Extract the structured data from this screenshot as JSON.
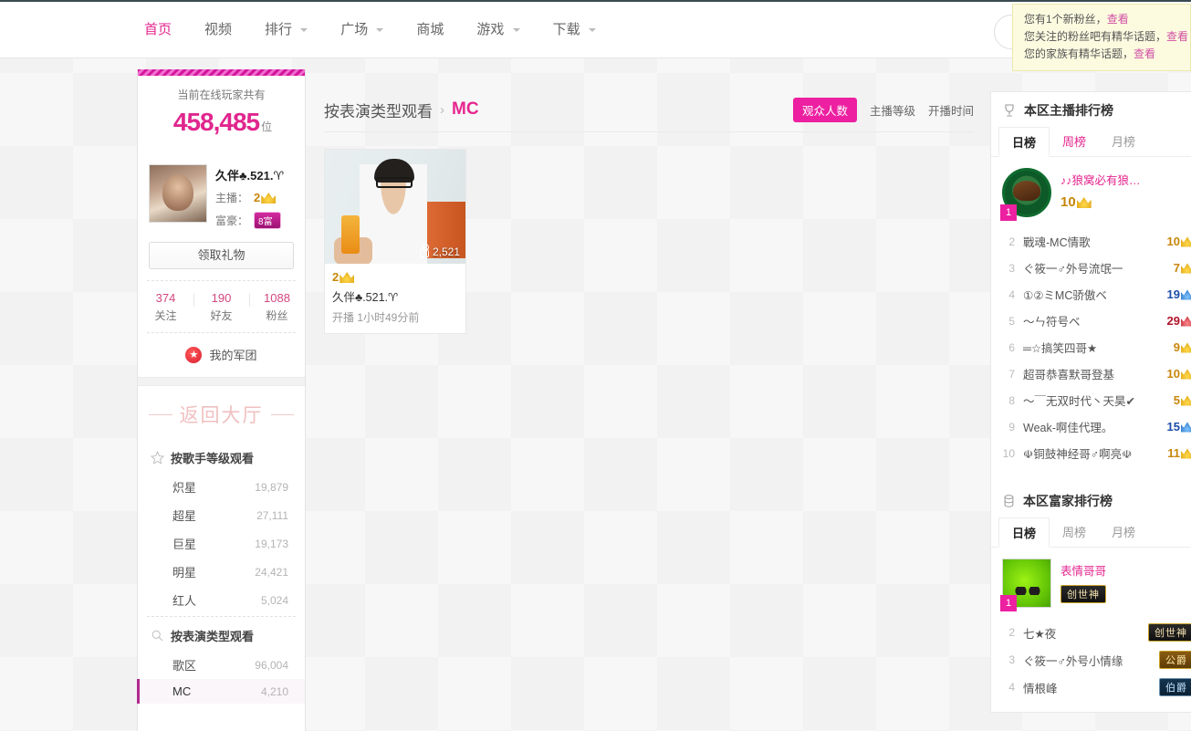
{
  "nav": {
    "items": [
      {
        "label": "首页",
        "caret": false,
        "active": true
      },
      {
        "label": "视频",
        "caret": false,
        "active": false
      },
      {
        "label": "排行",
        "caret": true,
        "active": false
      },
      {
        "label": "广场",
        "caret": true,
        "active": false
      },
      {
        "label": "商城",
        "caret": false,
        "active": false
      },
      {
        "label": "游戏",
        "caret": true,
        "active": false
      },
      {
        "label": "下载",
        "caret": true,
        "active": false
      }
    ]
  },
  "notify": {
    "rows": [
      {
        "text": "您有1个新粉丝，",
        "link": "查看"
      },
      {
        "text": "您关注的粉丝吧有精华话题，",
        "link": "查看"
      },
      {
        "text": "您的家族有精华话题，",
        "link": "查看"
      }
    ]
  },
  "sidebar": {
    "online_label": "当前在线玩家共有",
    "online_count": "458,485",
    "online_unit": "位",
    "user": {
      "name": "久伴♣.521.♈",
      "host_label": "主播：",
      "host_level": "2",
      "rich_label": "富豪：",
      "rich_badge": "8富"
    },
    "gift_button": "领取礼物",
    "stats": [
      {
        "num": "374",
        "label": "关注"
      },
      {
        "num": "190",
        "label": "好友"
      },
      {
        "num": "1088",
        "label": "粉丝"
      }
    ],
    "legion": "我的军团",
    "lobby": "返回大厅",
    "group_singer": {
      "title": "按歌手等级观看",
      "items": [
        {
          "name": "炽星",
          "count": "19,879"
        },
        {
          "name": "超星",
          "count": "27,111"
        },
        {
          "name": "巨星",
          "count": "19,173"
        },
        {
          "name": "明星",
          "count": "24,421"
        },
        {
          "name": "红人",
          "count": "5,024"
        }
      ]
    },
    "group_type": {
      "title": "按表演类型观看",
      "items": [
        {
          "name": "歌区",
          "count": "96,004",
          "selected": false
        },
        {
          "name": "MC",
          "count": "4,210",
          "selected": true
        }
      ]
    }
  },
  "main": {
    "breadcrumb_parent": "按表演类型观看",
    "breadcrumb_sep": "›",
    "breadcrumb_current": "MC",
    "filters": [
      {
        "label": "观众人数",
        "active": true
      },
      {
        "label": "主播等级",
        "active": false
      },
      {
        "label": "开播时间",
        "active": false
      }
    ],
    "cards": [
      {
        "viewers": "2,521",
        "level": "2",
        "name": "久伴♣.521.♈",
        "time": "开播 1小时49分前"
      }
    ]
  },
  "right": {
    "host_panel": {
      "title": "本区主播排行榜",
      "tabs": [
        {
          "label": "日榜",
          "active": true,
          "pink": false
        },
        {
          "label": "周榜",
          "active": false,
          "pink": true
        },
        {
          "label": "月榜",
          "active": false,
          "pink": false
        }
      ],
      "top1": {
        "rank": "1",
        "name": "♪♪狼窝必有狼…",
        "value": "10",
        "crown": "gold"
      },
      "rows": [
        {
          "idx": "2",
          "name": "戰魂-MC情歌",
          "value": "10",
          "crown": "gold"
        },
        {
          "idx": "3",
          "name": "ぐ筱一♂外号流氓一",
          "value": "7",
          "crown": "gold"
        },
        {
          "idx": "4",
          "name": "①②ミMC骄傲ベ",
          "value": "19",
          "crown": "blue"
        },
        {
          "idx": "5",
          "name": "〜ㄣ符号ベ",
          "value": "29",
          "crown": "red"
        },
        {
          "idx": "6",
          "name": "═☆搞笑四哥★",
          "value": "9",
          "crown": "gold"
        },
        {
          "idx": "7",
          "name": "超哥恭喜默哥登基",
          "value": "10",
          "crown": "gold"
        },
        {
          "idx": "8",
          "name": "〜￣无双时代丶天昊✔",
          "value": "5",
          "crown": "gold"
        },
        {
          "idx": "9",
          "name": "Weak-啊佳代理。",
          "value": "15",
          "crown": "blue"
        },
        {
          "idx": "10",
          "name": "☫铜鼓神经哥♂啊亮☫",
          "value": "11",
          "crown": "gold"
        }
      ]
    },
    "rich_panel": {
      "title": "本区富家排行榜",
      "tabs": [
        {
          "label": "日榜",
          "active": true,
          "pink": false
        },
        {
          "label": "周榜",
          "active": false,
          "pink": false
        },
        {
          "label": "月榜",
          "active": false,
          "pink": false
        }
      ],
      "top1": {
        "rank": "1",
        "name": "表情哥哥",
        "chip": "创世神"
      },
      "rows": [
        {
          "idx": "2",
          "name": "七★夜",
          "chip": "创世神",
          "style": "dark"
        },
        {
          "idx": "3",
          "name": "ぐ筱一♂外号小情缘",
          "chip": "公爵",
          "style": "gold"
        },
        {
          "idx": "4",
          "name": "情根峰",
          "chip": "伯爵",
          "style": "blue"
        }
      ]
    }
  }
}
